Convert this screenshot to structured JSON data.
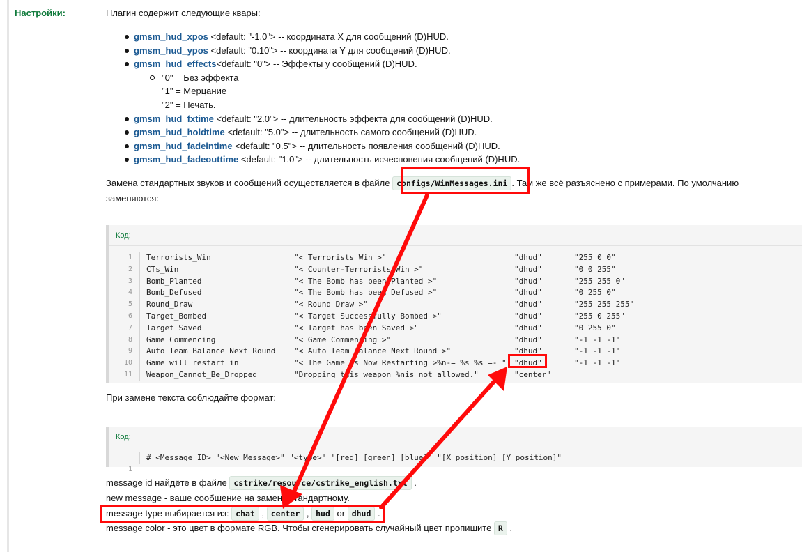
{
  "settings_label": "Настройки:",
  "intro": "Плагин содержит следующие квары:",
  "cvars": [
    {
      "name": "gmsm_hud_xpos",
      "desc": " <default: \"-1.0\"> -- координата X для сообщений (D)HUD."
    },
    {
      "name": "gmsm_hud_ypos",
      "desc": " <default: \"0.10\"> -- координата Y для сообщений (D)HUD."
    },
    {
      "name": "gmsm_hud_effects",
      "desc": "<default: \"0\"> -- Эффекты у сообщений (D)HUD."
    }
  ],
  "effects": [
    "\"0\" = Без эффекта",
    "\"1\" = Мерцание",
    "\"2\" = Печать."
  ],
  "cvars2": [
    {
      "name": "gmsm_hud_fxtime",
      "desc": " <default: \"2.0\"> -- длительность эффекта для сообщений (D)HUD."
    },
    {
      "name": "gmsm_hud_holdtime",
      "desc": " <default: \"5.0\"> -- длительность самого сообщений (D)HUD."
    },
    {
      "name": "gmsm_hud_fadeintime",
      "desc": " <default: \"0.5\"> -- длительность появления сообщений (D)HUD."
    },
    {
      "name": "gmsm_hud_fadeouttime",
      "desc": " <default: \"1.0\"> -- длительность исчесновения сообщений (D)HUD."
    }
  ],
  "para1": {
    "before": "Замена стандартных звуков и сообщений осуществляется в файле",
    "file": "configs/WinMessages.ini",
    "after": ". Там же всё разъяснено с примерами. По умолчанию",
    "line2": "заменяются:"
  },
  "code_label": "Код:",
  "code_lines": [
    {
      "n": "1",
      "id": "Terrorists_Win",
      "msg": "\"< Terrorists Win >\"",
      "type": "\"dhud\"",
      "color": "\"255 0 0\""
    },
    {
      "n": "2",
      "id": "CTs_Win",
      "msg": "\"< Counter-Terrorists Win >\"",
      "type": "\"dhud\"",
      "color": "\"0 0 255\""
    },
    {
      "n": "3",
      "id": "Bomb_Planted",
      "msg": "\"< The Bomb has been Planted >\"",
      "type": "\"dhud\"",
      "color": "\"255 255 0\""
    },
    {
      "n": "4",
      "id": "Bomb_Defused",
      "msg": "\"< The Bomb has been Defused >\"",
      "type": "\"dhud\"",
      "color": "\"0 255 0\""
    },
    {
      "n": "5",
      "id": "Round_Draw",
      "msg": "\"< Round Draw >\"",
      "type": "\"dhud\"",
      "color": "\"255 255 255\""
    },
    {
      "n": "6",
      "id": "Target_Bombed",
      "msg": "\"< Target Successfully Bombed >\"",
      "type": "\"dhud\"",
      "color": "\"255 0 255\""
    },
    {
      "n": "7",
      "id": "Target_Saved",
      "msg": "\"< Target has been Saved >\"",
      "type": "\"dhud\"",
      "color": "\"0 255 0\""
    },
    {
      "n": "8",
      "id": "Game_Commencing",
      "msg": "\"< Game Commencing >\"",
      "type": "\"dhud\"",
      "color": "\"-1 -1 -1\""
    },
    {
      "n": "9",
      "id": "Auto_Team_Balance_Next_Round",
      "msg": "\"< Auto Team Balance Next Round >\"",
      "type": "\"dhud\"",
      "color": "\"-1 -1 -1\""
    },
    {
      "n": "10",
      "id": "Game_will_restart_in",
      "msg": "\"< The Game is Now Restarting >%n-= %s %s =- \"",
      "type": "\"dhud\"",
      "color": "\"-1 -1 -1\""
    },
    {
      "n": "11",
      "id": "Weapon_Cannot_Be_Dropped",
      "msg": "\"Dropping this weapon %nis not allowed.\"",
      "type": "\"center\"",
      "color": ""
    }
  ],
  "rule_text": "При замене текста соблюдайте формат:",
  "format_line": {
    "n": "1",
    "text": "# <Message ID> \"<New Message>\" \"<type>\" \"[red] [green] [blue]\" \"[X position] [Y position]\""
  },
  "bottom": {
    "l1_before": "message id найдёте в файле ",
    "l1_code": "cstrike/resource/cstrike_english.txt",
    "l1_after": " .",
    "l2": "new message - ваше сообшение на замену стандартному.",
    "l3_before": "message type выбирается из: ",
    "types": [
      "chat",
      "center",
      "hud",
      "dhud"
    ],
    "l3_or": " or ",
    "l3_after": " .",
    "l4_before": "message color - это цвет в формате RGB. Чтобы сгенерировать случайный цвет пропишите ",
    "l4_code": "R",
    "l4_after": " ."
  },
  "accent_color": "#ff0a0a"
}
